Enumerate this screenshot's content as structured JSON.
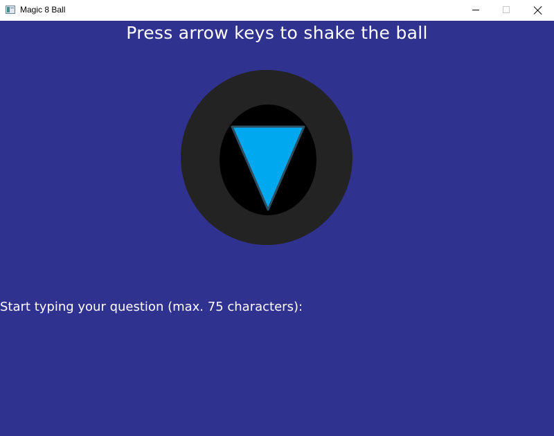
{
  "window": {
    "title": "Magic 8 Ball",
    "icon": "app-window-icon",
    "controls": {
      "minimize_icon": "minimize-icon",
      "maximize_icon": "maximize-icon",
      "close_icon": "close-icon"
    }
  },
  "game": {
    "instruction": "Press arrow keys to shake the ball",
    "question_prompt": "Start typing your question (max. 75 characters):",
    "colors": {
      "background": "#303290",
      "ball_outer": "#232323",
      "ball_window": "#000000",
      "triangle": "#00a8f0",
      "text": "#ffffff"
    }
  }
}
